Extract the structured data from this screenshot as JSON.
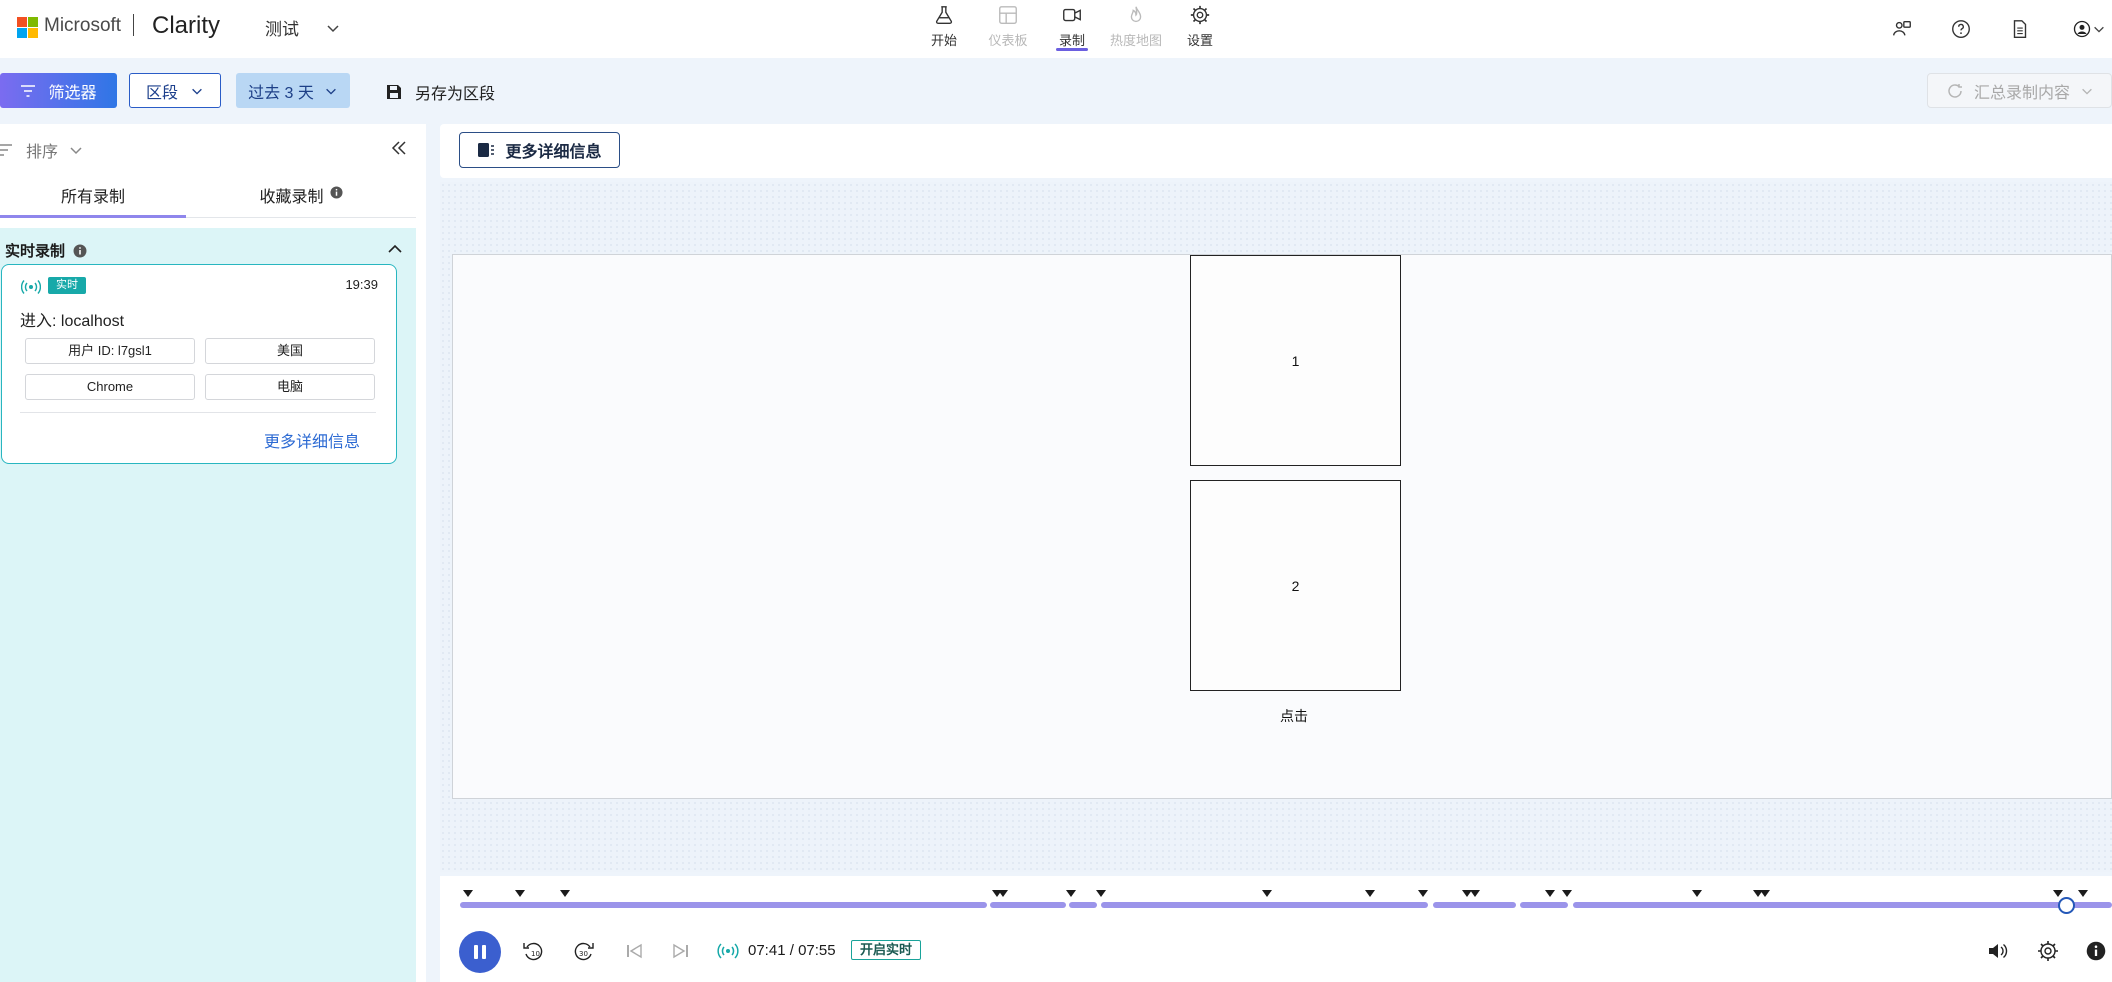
{
  "header": {
    "ms_text": "Microsoft",
    "brand": "Clarity",
    "project": "测试",
    "nav": [
      {
        "label": "开始",
        "icon": "flask-icon",
        "state": "normal"
      },
      {
        "label": "仪表板",
        "icon": "dashboard-icon",
        "state": "disabled"
      },
      {
        "label": "录制",
        "icon": "video-icon",
        "state": "active"
      },
      {
        "label": "热度地图",
        "icon": "flame-icon",
        "state": "disabled"
      },
      {
        "label": "设置",
        "icon": "gear-icon",
        "state": "normal"
      }
    ],
    "right_icons": [
      "people-icon",
      "help-icon",
      "document-icon",
      "account-icon"
    ]
  },
  "toolbar": {
    "filter_label": "筛选器",
    "segment_label": "区段",
    "range_label": "过去 3 天",
    "save_label": "另存为区段",
    "summary_label": "汇总录制内容"
  },
  "sidebar": {
    "sort_label": "排序",
    "tabs": [
      {
        "label": "所有录制",
        "active": true
      },
      {
        "label": "收藏录制",
        "active": false
      }
    ],
    "live_section": {
      "title": "实时录制",
      "card": {
        "badge": "实时",
        "time": "19:39",
        "entry_label": "进入:",
        "entry_value": "localhost",
        "chips": [
          "用户 ID: l7gsl1",
          "美国",
          "Chrome",
          "电脑"
        ],
        "more_link": "更多详细信息"
      }
    }
  },
  "main": {
    "more_details_label": "更多详细信息",
    "boxes": [
      "1",
      "2"
    ],
    "click_label": "点击"
  },
  "player": {
    "current_time": "07:41",
    "total_time": "07:55",
    "time_separator": " / ",
    "go_live_label": "开启实时",
    "progress_fraction": 0.967
  },
  "colors": {
    "accent": "#6b5fe0",
    "primary_blue": "#2f76e6",
    "live_teal": "#17a9a9",
    "track": "#9b94ea"
  }
}
